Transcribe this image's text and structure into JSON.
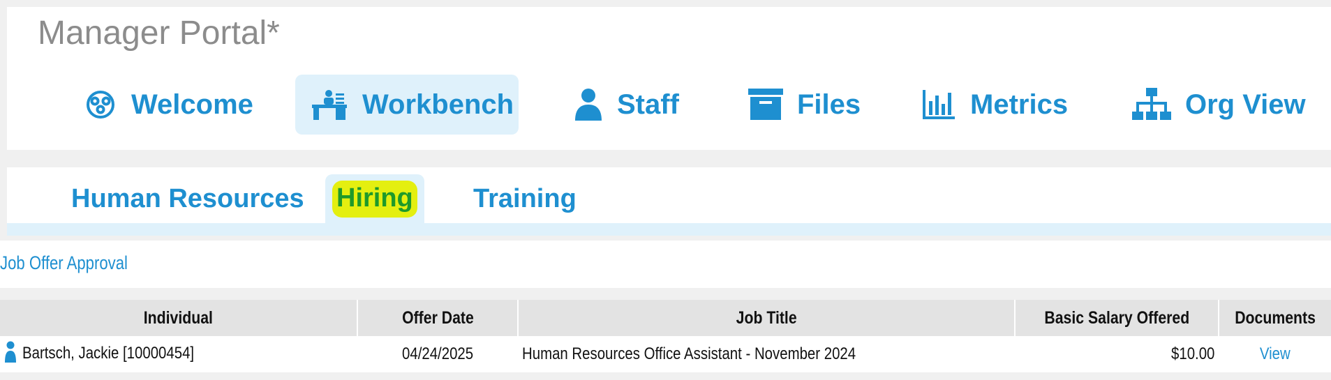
{
  "app": {
    "title": "Manager Portal*"
  },
  "nav": [
    {
      "label": "Welcome",
      "icon": "group-icon",
      "active": false
    },
    {
      "label": "Workbench",
      "icon": "workbench-desk-icon",
      "active": true
    },
    {
      "label": "Staff",
      "icon": "person-icon",
      "active": false
    },
    {
      "label": "Files",
      "icon": "archive-box-icon",
      "active": false
    },
    {
      "label": "Metrics",
      "icon": "bar-chart-icon",
      "active": false
    },
    {
      "label": "Org View",
      "icon": "org-chart-icon",
      "active": false
    }
  ],
  "subtabs": [
    {
      "label": "Human Resources",
      "active": false
    },
    {
      "label": "Hiring",
      "active": true,
      "highlighted": true
    },
    {
      "label": "Training",
      "active": false
    }
  ],
  "section": {
    "link": "Job Offer Approval"
  },
  "table": {
    "columns": [
      "Individual",
      "Offer Date",
      "Job Title",
      "Basic Salary Offered",
      "Documents"
    ],
    "rows": [
      {
        "individual": "Bartsch, Jackie [10000454]",
        "offer_date": "04/24/2025",
        "job_title": "Human Resources Office Assistant - November 2024",
        "salary": "$10.00",
        "documents": "View",
        "icon": "person-icon"
      }
    ]
  },
  "colors": {
    "accent": "#1e8fd0",
    "active_bg": "#dff1fb",
    "highlight": "#e4ef10",
    "highlight_text": "#1e9a2a",
    "title_gray": "#8c8c8c",
    "page_bg": "#f0f0f0",
    "header_row_bg": "#e3e3e3"
  }
}
